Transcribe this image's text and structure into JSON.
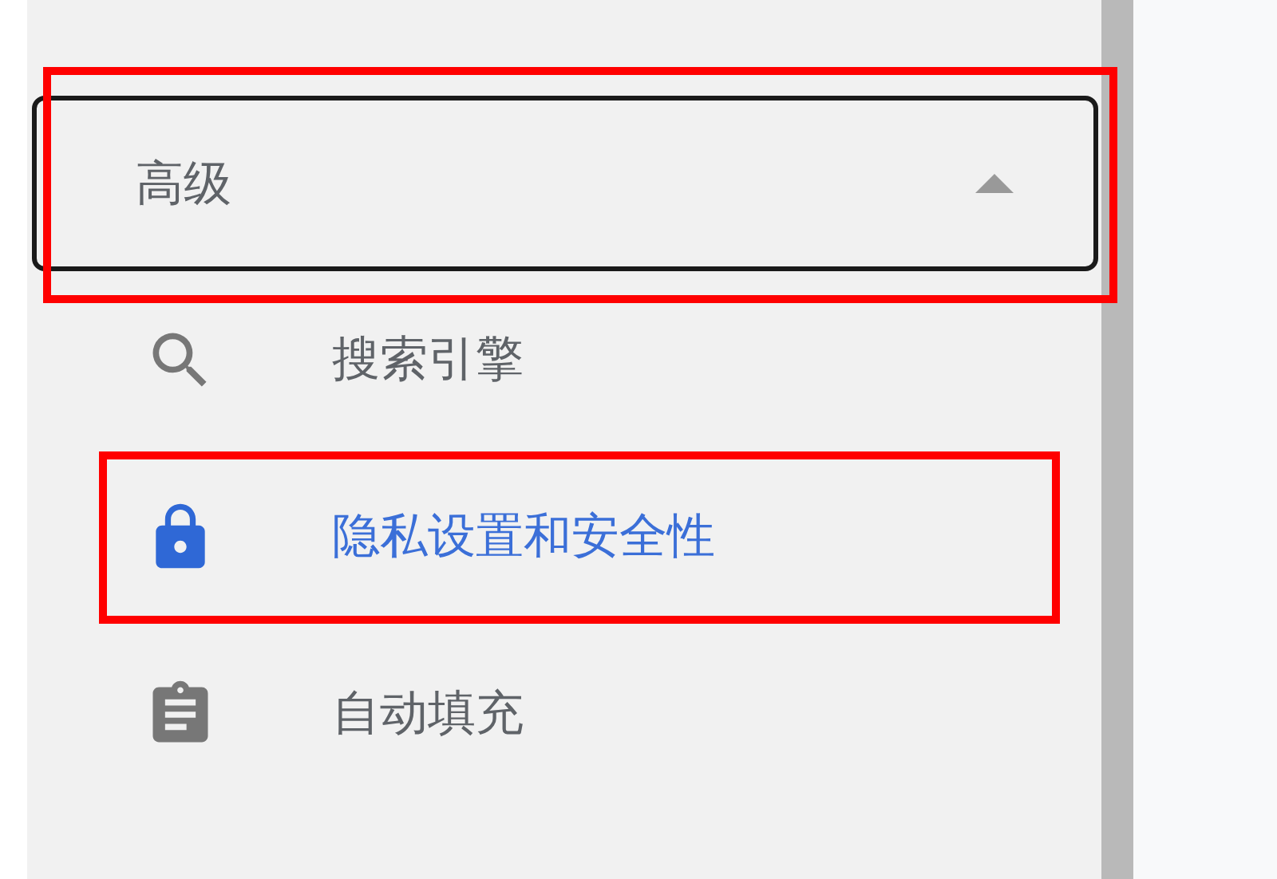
{
  "advanced": {
    "label": "高级",
    "expanded": true,
    "highlighted": true
  },
  "items": [
    {
      "label": "搜索引擎",
      "selected": false,
      "highlighted": false
    },
    {
      "label": "隐私设置和安全性",
      "selected": true,
      "highlighted": true
    },
    {
      "label": "自动填充",
      "selected": false,
      "highlighted": false
    }
  ]
}
